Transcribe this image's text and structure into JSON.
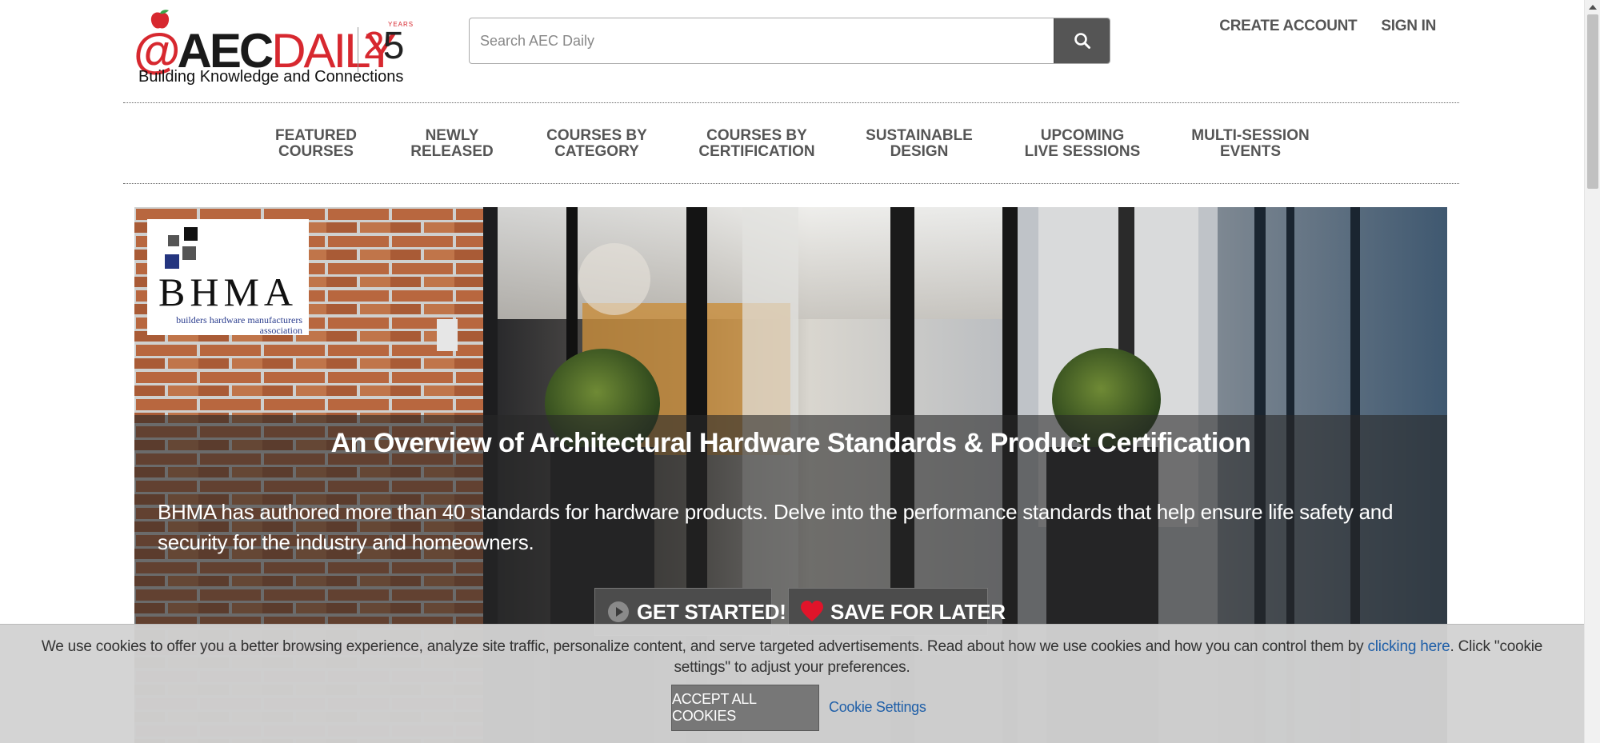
{
  "header": {
    "logo": {
      "at": "@",
      "aec": "AEC",
      "daily": "DAILY",
      "anniversary_digit_1": "2",
      "anniversary_digit_2": "5",
      "anniversary_word": "YEARS",
      "tagline": "Building Knowledge and Connections"
    },
    "search": {
      "placeholder": "Search AEC Daily",
      "value": "",
      "button_icon": "search-icon"
    },
    "top_links": {
      "create_account": "CREATE ACCOUNT",
      "sign_in": "SIGN IN"
    }
  },
  "nav": {
    "items": [
      {
        "line1": "FEATURED",
        "line2": "COURSES"
      },
      {
        "line1": "NEWLY",
        "line2": "RELEASED"
      },
      {
        "line1": "COURSES BY",
        "line2": "CATEGORY"
      },
      {
        "line1": "COURSES BY",
        "line2": "CERTIFICATION"
      },
      {
        "line1": "SUSTAINABLE",
        "line2": "DESIGN"
      },
      {
        "line1": "UPCOMING",
        "line2": "LIVE SESSIONS"
      },
      {
        "line1": "MULTI-SESSION",
        "line2": "EVENTS"
      }
    ]
  },
  "hero": {
    "sponsor": {
      "name": "BHMA",
      "subtitle_line1": "builders hardware manufacturers",
      "subtitle_line2": "association"
    },
    "title": "An Overview of Architectural Hardware Standards & Product Certification",
    "description": "BHMA has authored more than 40 standards for hardware products. Delve into the performance standards that help ensure life safety and security for the industry and homeowners.",
    "buttons": {
      "get_started": {
        "label": "GET STARTED!",
        "icon": "play-circle-icon"
      },
      "save_for_later": {
        "label": "SAVE FOR LATER",
        "icon": "heart-icon"
      }
    }
  },
  "cookie_banner": {
    "icon_glyph": "",
    "text_before": "We use cookies to offer you a better browsing experience, analyze site traffic, personalize content, and serve targeted advertisements. Read about how we use cookies and how you can control them by ",
    "link_text": "clicking here",
    "text_after": ". Click \"cookie settings\" to adjust your preferences.",
    "accept_label": "ACCEPT ALL COOKIES",
    "settings_label": "Cookie Settings"
  },
  "colors": {
    "brand_red": "#d7282f",
    "link_blue": "#1f5fa8",
    "heart_red": "#e0142a"
  }
}
